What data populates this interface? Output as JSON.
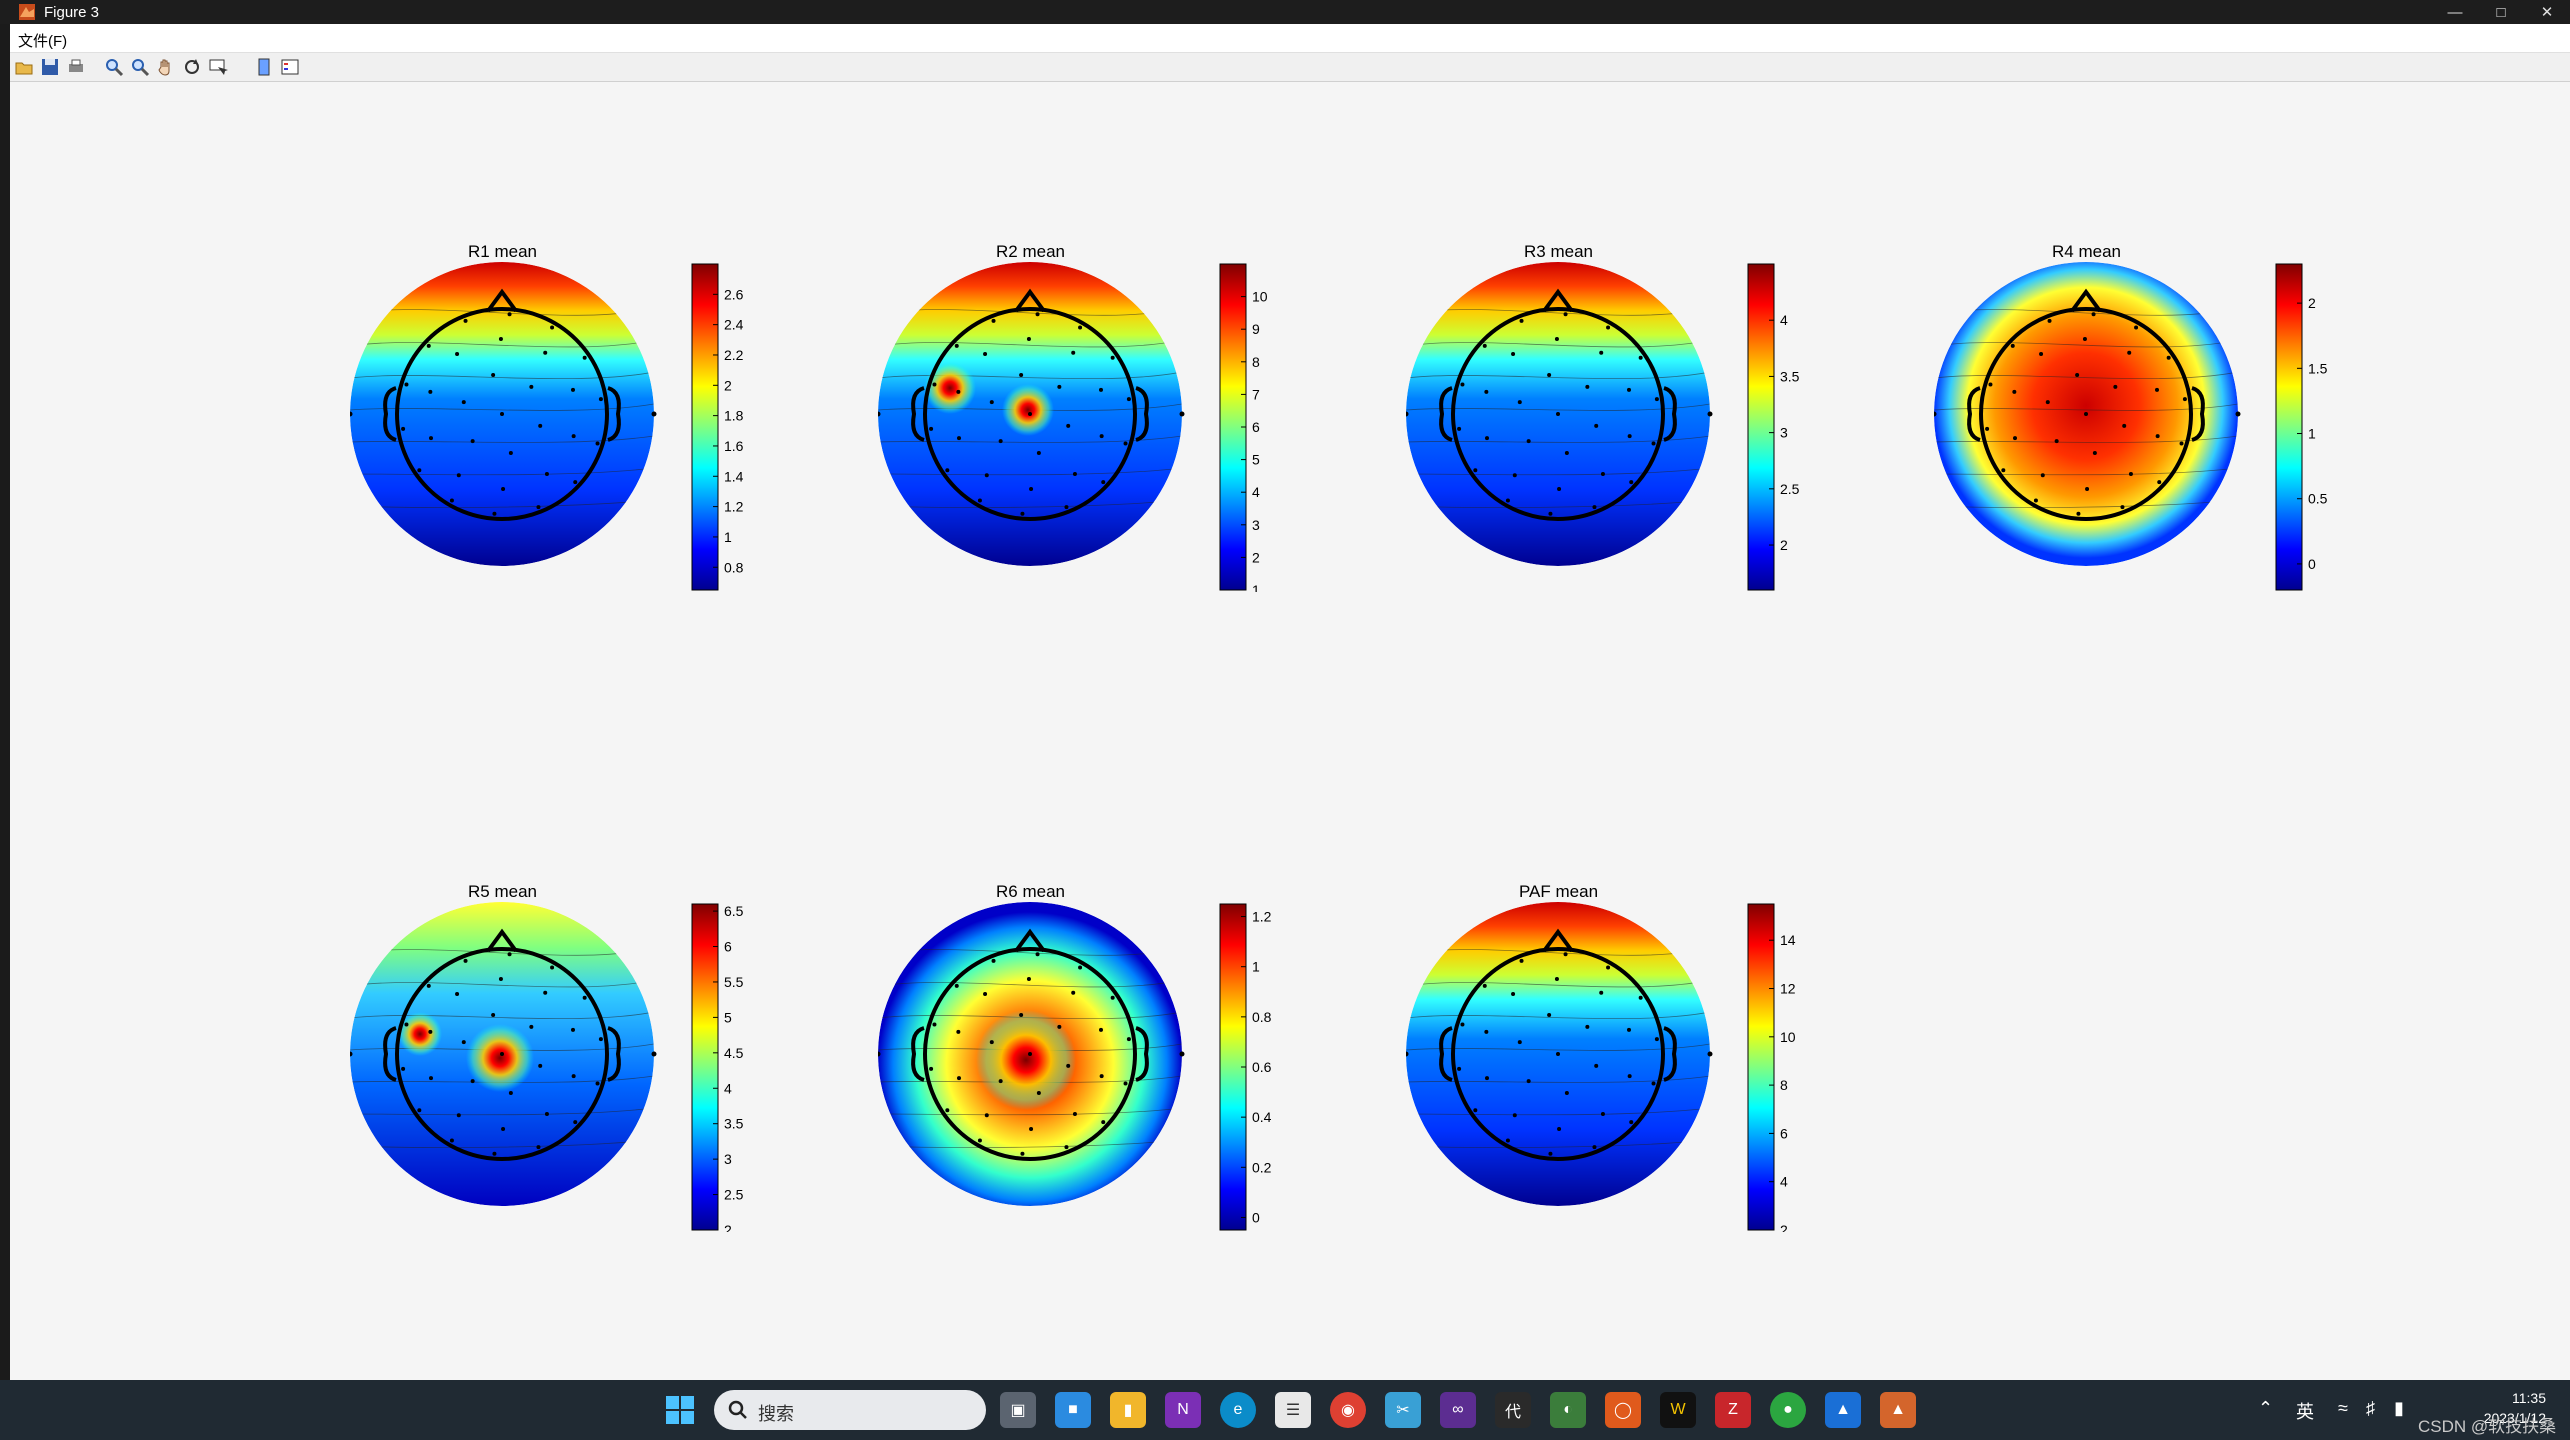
{
  "window": {
    "title": "Figure 3"
  },
  "menu": {
    "file": "文件(F)"
  },
  "toolbar": {
    "buttons": [
      "open-icon",
      "save-icon",
      "print-icon",
      "zoom-in-icon",
      "zoom-out-icon",
      "pan-icon",
      "rotate-icon",
      "data-cursor-icon",
      "colorbar-icon",
      "legend-icon"
    ]
  },
  "chart_data": [
    {
      "type": "heatmap",
      "title": "R1 mean",
      "colorbar_ticks": [
        0.8,
        1,
        1.2,
        1.4,
        1.6,
        1.8,
        2,
        2.2,
        2.4,
        2.6
      ],
      "clim": [
        0.65,
        2.8
      ],
      "colormap": "jet",
      "pattern": "front-hot"
    },
    {
      "type": "heatmap",
      "title": "R2 mean",
      "colorbar_ticks": [
        1,
        2,
        3,
        4,
        5,
        6,
        7,
        8,
        9,
        10
      ],
      "clim": [
        1,
        11
      ],
      "colormap": "jet",
      "pattern": "front-hot-with-two-hotspots"
    },
    {
      "type": "heatmap",
      "title": "R3 mean",
      "colorbar_ticks": [
        2,
        2.5,
        3,
        3.5,
        4
      ],
      "clim": [
        1.6,
        4.5
      ],
      "colormap": "jet",
      "pattern": "front-hot"
    },
    {
      "type": "heatmap",
      "title": "R4 mean",
      "colorbar_ticks": [
        0,
        0.5,
        1,
        1.5,
        2
      ],
      "clim": [
        -0.2,
        2.3
      ],
      "colormap": "jet",
      "pattern": "central-hot"
    },
    {
      "type": "heatmap",
      "title": "R5 mean",
      "colorbar_ticks": [
        2,
        2.5,
        3,
        3.5,
        4,
        4.5,
        5,
        5.5,
        6,
        6.5
      ],
      "clim": [
        2,
        6.6
      ],
      "colormap": "jet",
      "pattern": "two-hotspots"
    },
    {
      "type": "heatmap",
      "title": "R6 mean",
      "colorbar_ticks": [
        0,
        0.2,
        0.4,
        0.6,
        0.8,
        1,
        1.2
      ],
      "clim": [
        -0.05,
        1.25
      ],
      "colormap": "jet",
      "pattern": "central-posterior-hot"
    },
    {
      "type": "heatmap",
      "title": "PAF mean",
      "colorbar_ticks": [
        2,
        4,
        6,
        8,
        10,
        12,
        14
      ],
      "clim": [
        2,
        15.5
      ],
      "colormap": "jet",
      "pattern": "front-hot"
    }
  ],
  "taskbar": {
    "search_label": "搜索",
    "apps": [
      "start-icon",
      "file-explorer-icon",
      "widgets-icon",
      "folder-icon",
      "onenote-icon",
      "edge-icon",
      "notepad-icon",
      "chrome-icon",
      "snipping-icon",
      "visual-studio-icon",
      "code-icon",
      "app-icon",
      "ubuntu-icon",
      "wps-icon",
      "app2-icon",
      "wechat-icon",
      "meeting-icon",
      "matlab-icon"
    ],
    "ime": "英",
    "time": "11:35",
    "date": "2023/1/12",
    "watermark": "CSDN @软技扶桑"
  }
}
